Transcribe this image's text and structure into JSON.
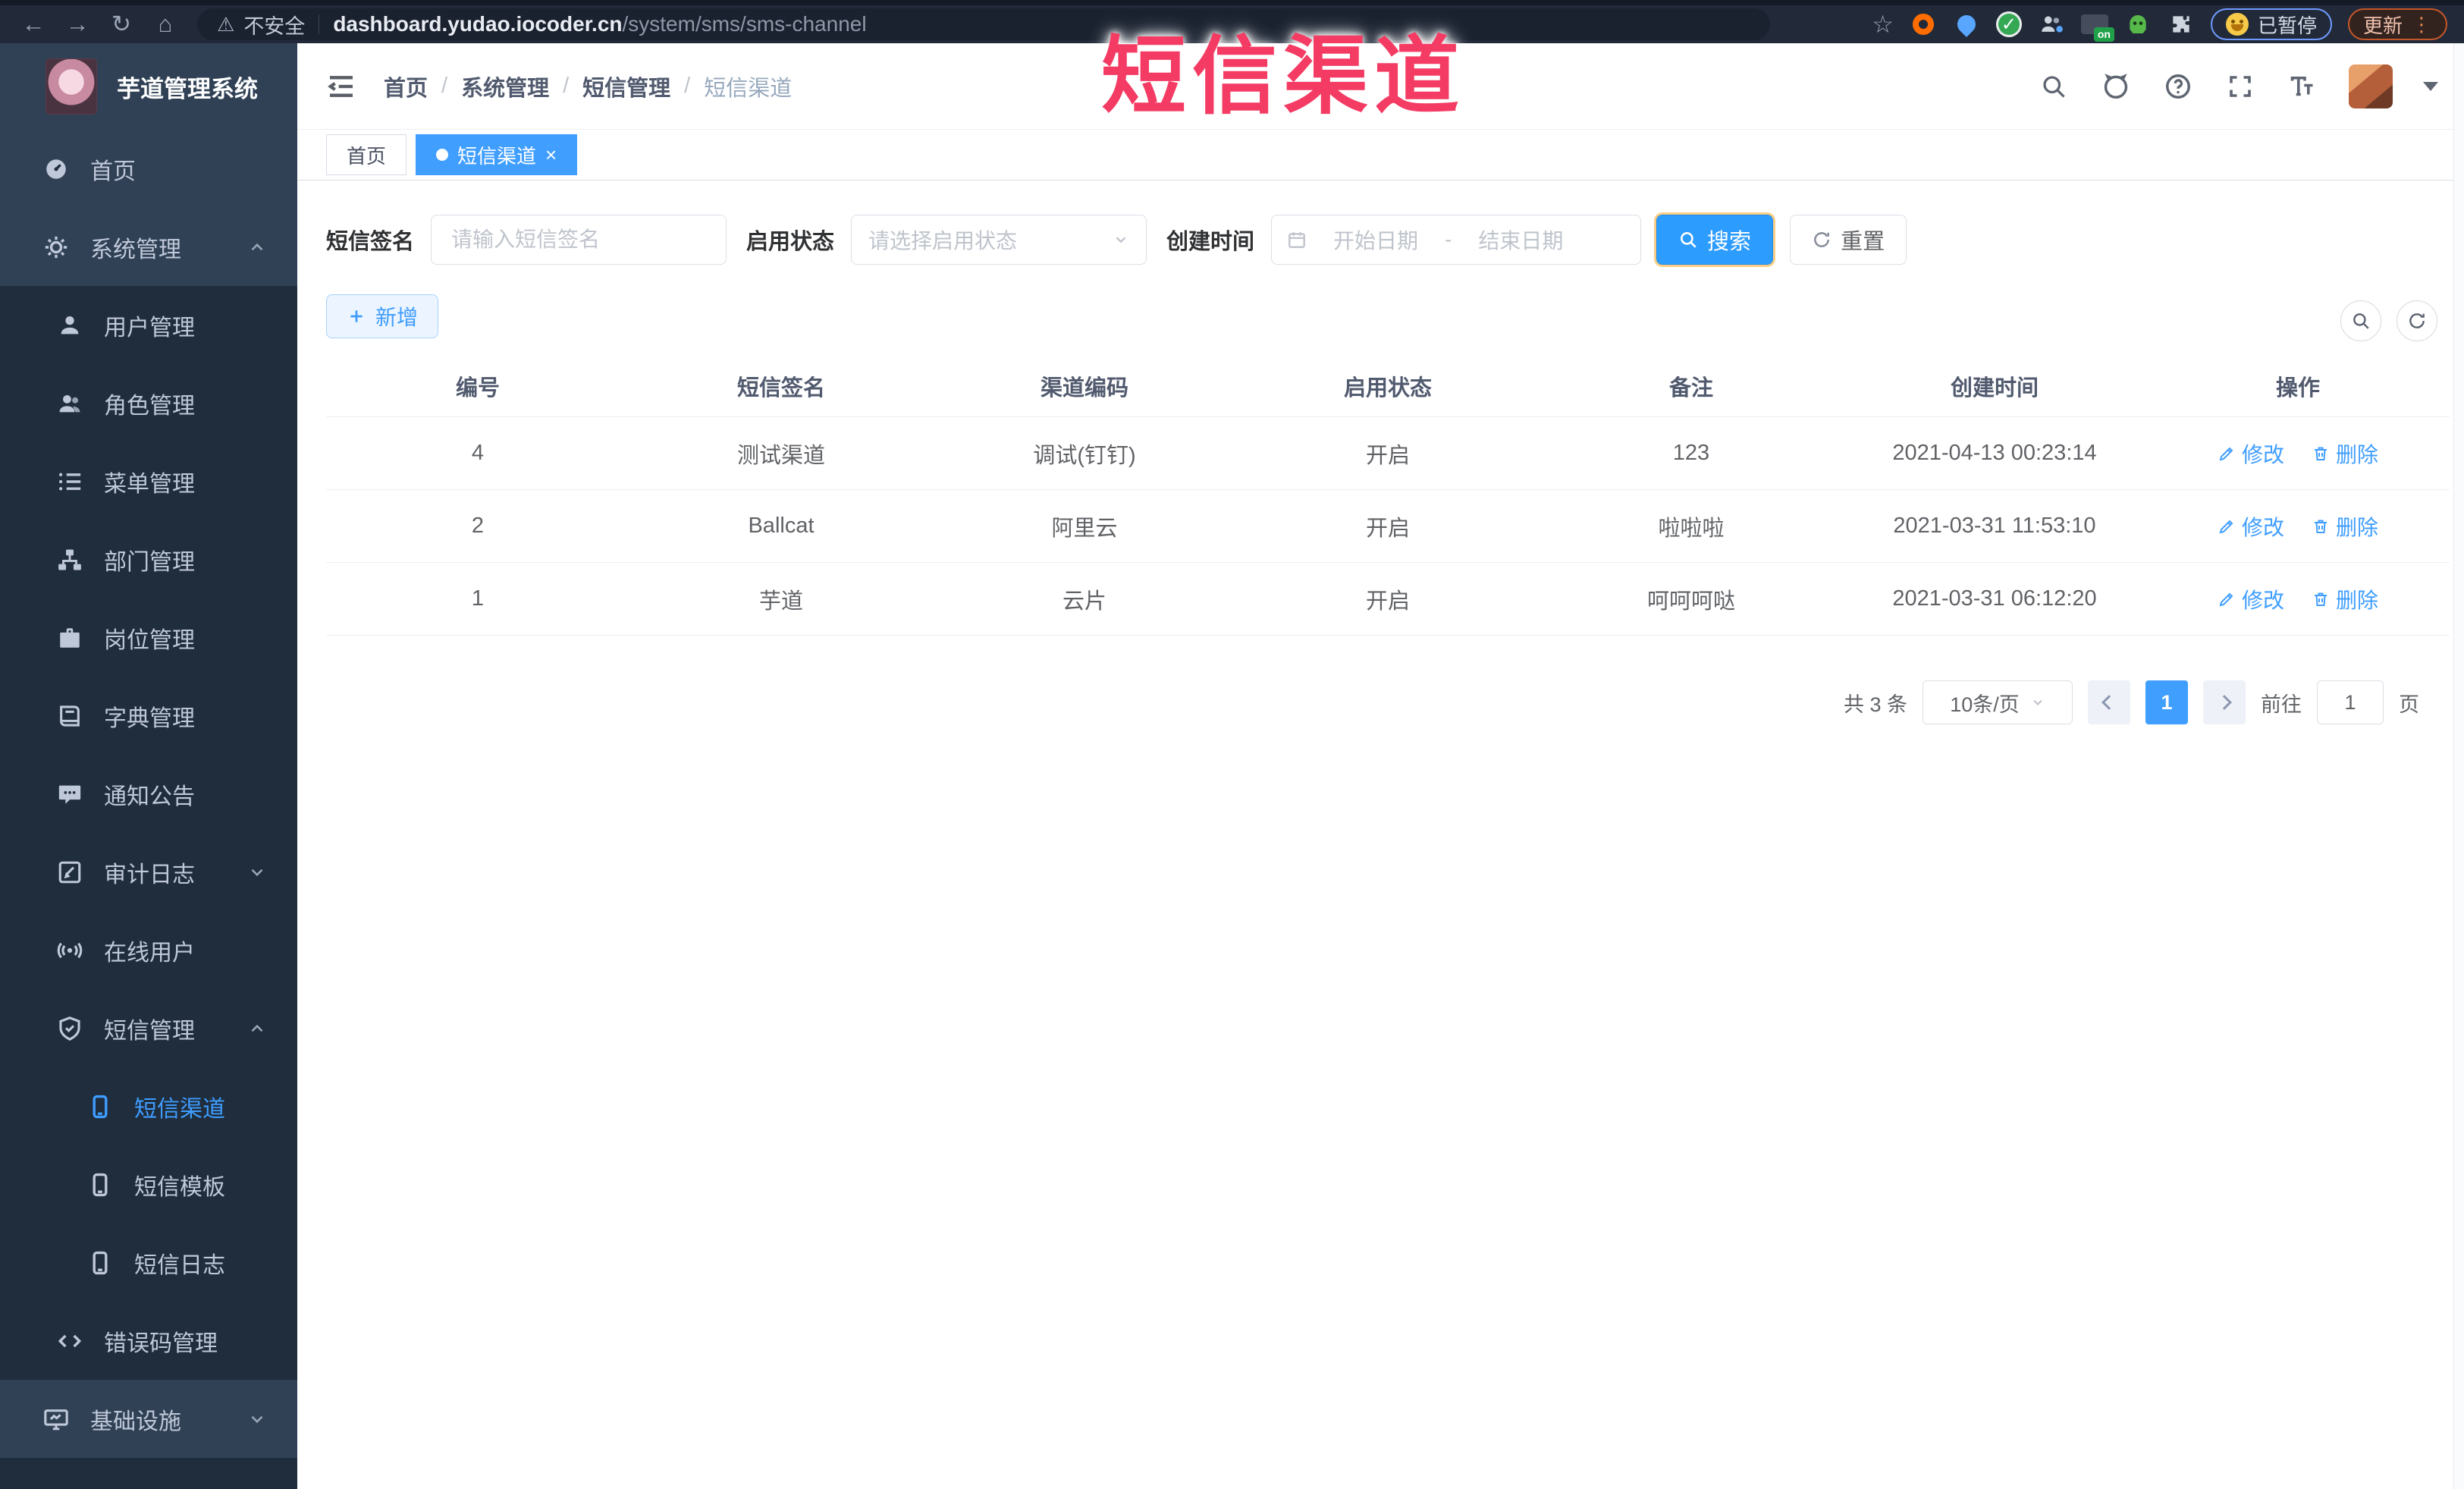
{
  "browser": {
    "security_label": "不安全",
    "url_host": "dashboard.yudao.iocoder.cn",
    "url_path": "/system/sms/sms-channel",
    "on_badge": "on",
    "paused_label": "已暂停",
    "update_label": "更新"
  },
  "glyphs": {
    "back": "←",
    "forward": "→",
    "reload": "↻",
    "home": "⌂",
    "warning": "⚠",
    "star": "☆",
    "check": "✓",
    "close": "×",
    "slash": "/",
    "question": "?",
    "dots_vertical": "⋮"
  },
  "sidebar": {
    "logo_title": "芋道管理系统",
    "items": [
      {
        "label": "首页",
        "icon": "dashboard-icon"
      },
      {
        "label": "系统管理",
        "icon": "gear-icon"
      },
      {
        "label": "用户管理",
        "icon": "user-icon"
      },
      {
        "label": "角色管理",
        "icon": "users-icon"
      },
      {
        "label": "菜单管理",
        "icon": "menu-list-icon"
      },
      {
        "label": "部门管理",
        "icon": "org-tree-icon"
      },
      {
        "label": "岗位管理",
        "icon": "briefcase-icon"
      },
      {
        "label": "字典管理",
        "icon": "dictionary-icon"
      },
      {
        "label": "通知公告",
        "icon": "announcement-icon"
      },
      {
        "label": "审计日志",
        "icon": "audit-log-icon"
      },
      {
        "label": "在线用户",
        "icon": "online-user-icon"
      },
      {
        "label": "短信管理",
        "icon": "sms-shield-icon"
      },
      {
        "label": "短信渠道",
        "icon": "phone-icon"
      },
      {
        "label": "短信模板",
        "icon": "phone-icon"
      },
      {
        "label": "短信日志",
        "icon": "phone-icon"
      },
      {
        "label": "错误码管理",
        "icon": "code-icon"
      },
      {
        "label": "基础设施",
        "icon": "monitor-icon"
      }
    ]
  },
  "header": {
    "breadcrumb": [
      "首页",
      "系统管理",
      "短信管理",
      "短信渠道"
    ]
  },
  "tabs": [
    {
      "label": "首页"
    },
    {
      "label": "短信渠道"
    }
  ],
  "watermark": "短信渠道",
  "search_form": {
    "sign_label": "短信签名",
    "sign_placeholder": "请输入短信签名",
    "status_label": "启用状态",
    "status_placeholder": "请选择启用状态",
    "time_label": "创建时间",
    "date_start_placeholder": "开始日期",
    "date_separator": "-",
    "date_end_placeholder": "结束日期",
    "search_label": "搜索",
    "reset_label": "重置"
  },
  "toolbar": {
    "add_label": "新增"
  },
  "table": {
    "columns": [
      "编号",
      "短信签名",
      "渠道编码",
      "启用状态",
      "备注",
      "创建时间",
      "操作"
    ],
    "rows": [
      {
        "id": "4",
        "sign": "测试渠道",
        "code": "调试(钉钉)",
        "status": "开启",
        "remark": "123",
        "created": "2021-04-13 00:23:14"
      },
      {
        "id": "2",
        "sign": "Ballcat",
        "code": "阿里云",
        "status": "开启",
        "remark": "啦啦啦",
        "created": "2021-03-31 11:53:10"
      },
      {
        "id": "1",
        "sign": "芋道",
        "code": "云片",
        "status": "开启",
        "remark": "呵呵呵哒",
        "created": "2021-03-31 06:12:20"
      }
    ],
    "edit_label": "修改",
    "delete_label": "删除"
  },
  "pagination": {
    "total": "共 3 条",
    "page_size": "10条/页",
    "current": "1",
    "goto_label": "前往",
    "goto_value": "1",
    "page_unit": "页"
  },
  "colors": {
    "accent": "#409EFF",
    "sidebar_bg": "#304156",
    "sidebar_sub_bg": "#1f2d3d",
    "watermark": "#f43b63",
    "link": "#409EFF",
    "tag_active_bg": "#409EFF"
  }
}
